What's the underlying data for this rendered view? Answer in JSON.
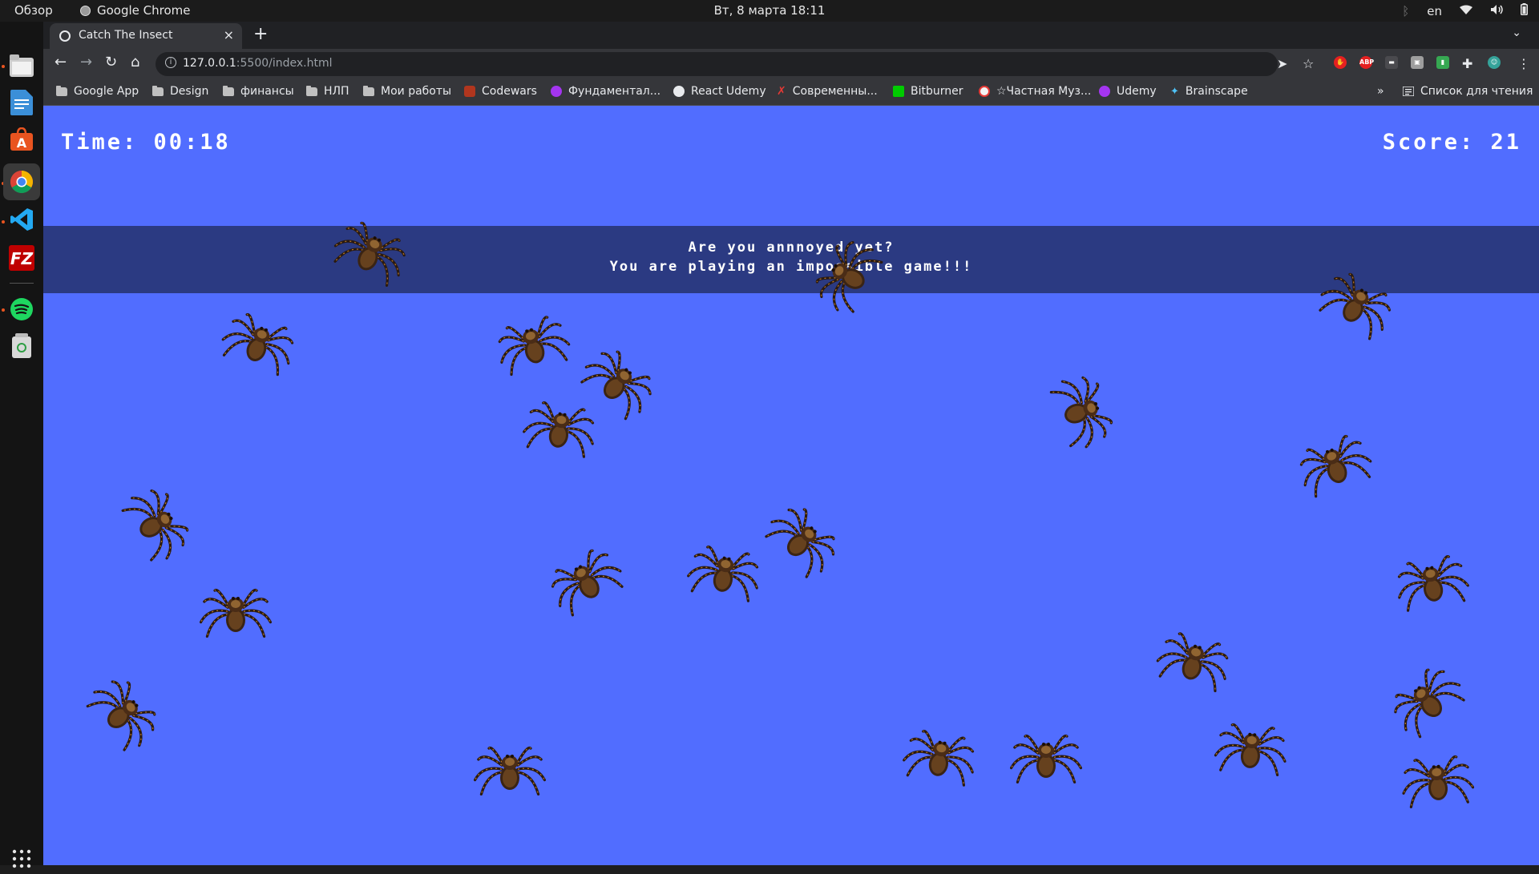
{
  "os": {
    "overview_label": "Обзор",
    "active_app": "Google Chrome",
    "clock": "Вт, 8 марта  18:11",
    "language": "en",
    "dock_apps": [
      "files-icon",
      "text-editor-icon",
      "software-center-icon",
      "chrome-icon",
      "vscode-icon",
      "filezilla-icon",
      "spotify-icon",
      "trash-icon",
      "app-grid-icon"
    ]
  },
  "browser": {
    "tab_title": "Catch The Insect",
    "url_host": "127.0.0.1",
    "url_path": ":5500/index.html",
    "bookmarks": [
      {
        "label": "Google App",
        "icon": "folder-icon"
      },
      {
        "label": "Design",
        "icon": "folder-icon"
      },
      {
        "label": "финансы",
        "icon": "folder-icon"
      },
      {
        "label": "НЛП",
        "icon": "folder-icon"
      },
      {
        "label": "Мои работы",
        "icon": "folder-icon"
      },
      {
        "label": "Codewars",
        "icon": "codewars-icon"
      },
      {
        "label": "Фундаментал...",
        "icon": "udemy-icon"
      },
      {
        "label": "React Udemy",
        "icon": "globe-icon"
      },
      {
        "label": "Современны...",
        "icon": "x-icon"
      },
      {
        "label": "Bitburner",
        "icon": "bitburner-icon"
      },
      {
        "label": "☆Частная Муз...",
        "icon": "music-icon"
      },
      {
        "label": "Udemy",
        "icon": "udemy-icon"
      },
      {
        "label": "Brainscape",
        "icon": "brainscape-icon"
      }
    ],
    "more_bookmarks": "»",
    "reading_list": "Список для чтения"
  },
  "game": {
    "time_label": "Time: 00:18",
    "score_label": "Score: 21",
    "message_line1": "Are you annnoyed yet?",
    "message_line2": "You are playing an impossible game!!!",
    "insect_count": 23,
    "colors": {
      "background": "#516dff",
      "message_bar": "#2b3a82"
    }
  }
}
